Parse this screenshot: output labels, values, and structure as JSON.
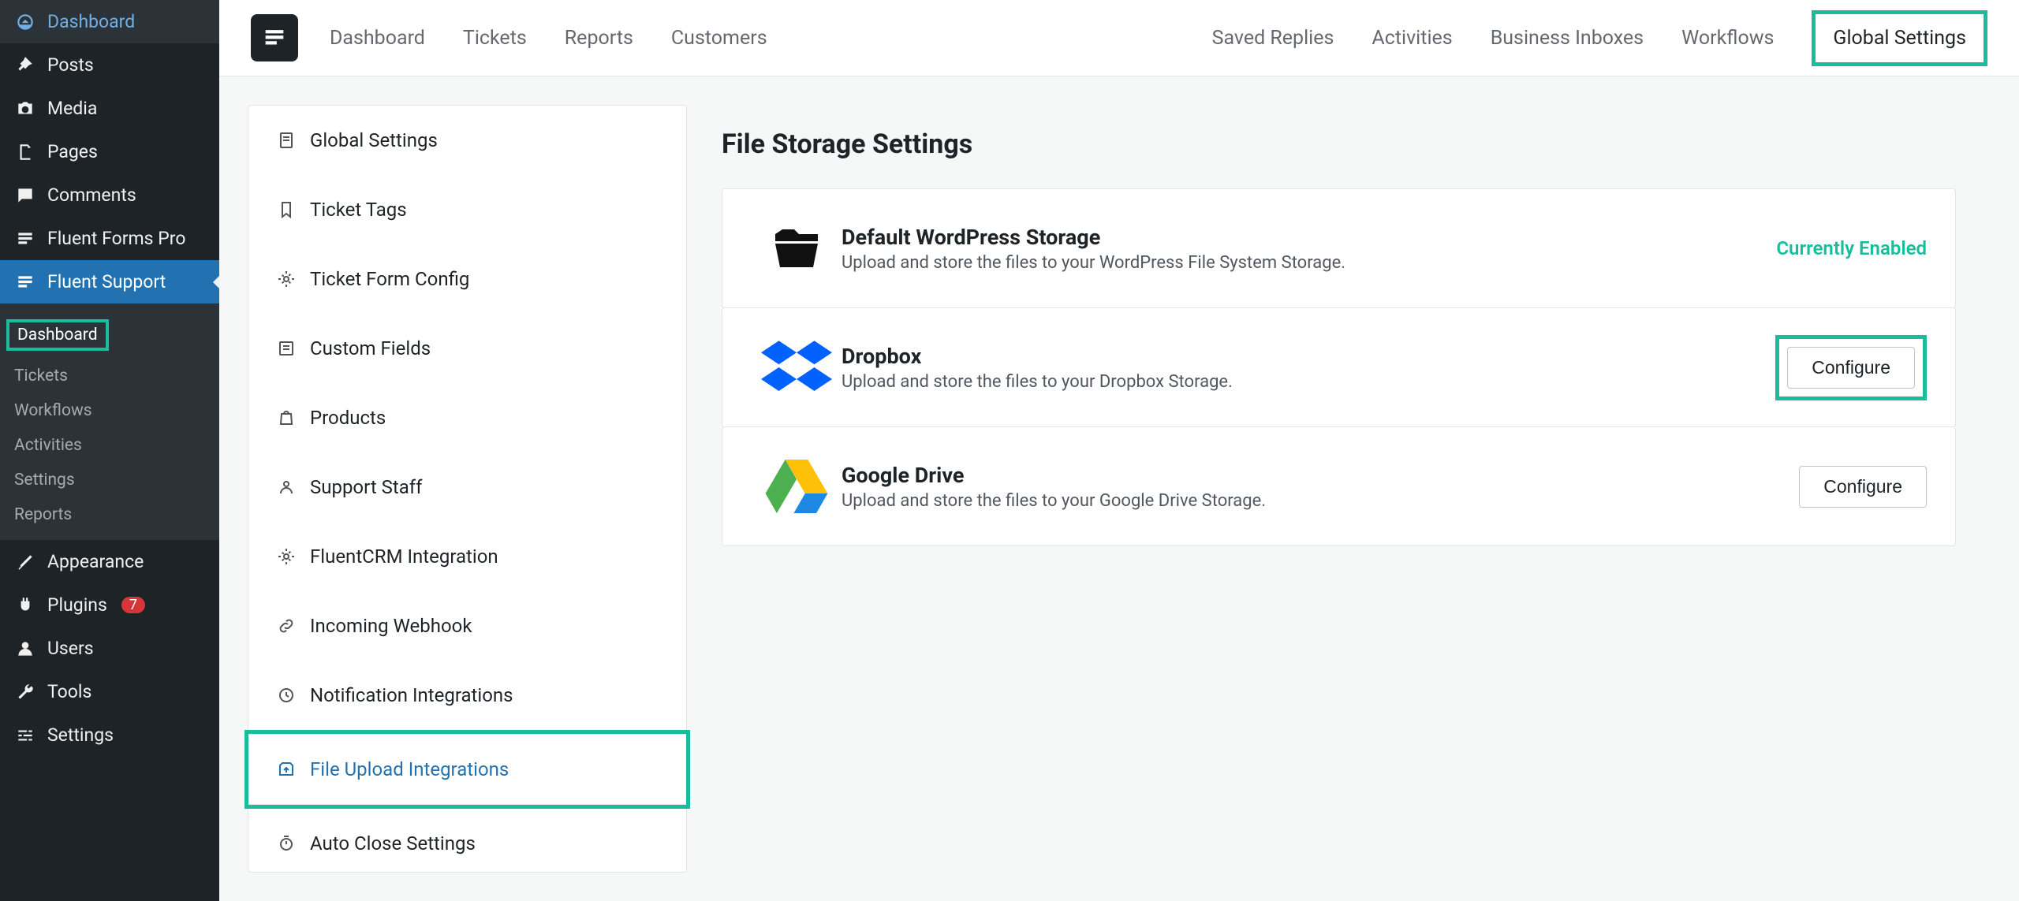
{
  "wp_sidebar": {
    "dashboard": "Dashboard",
    "posts": "Posts",
    "media": "Media",
    "pages": "Pages",
    "comments": "Comments",
    "fluent_forms": "Fluent Forms Pro",
    "fluent_support": "Fluent Support",
    "submenu": {
      "dashboard": "Dashboard",
      "tickets": "Tickets",
      "workflows": "Workflows",
      "activities": "Activities",
      "settings": "Settings",
      "reports": "Reports"
    },
    "appearance": "Appearance",
    "plugins": "Plugins",
    "plugins_badge": "7",
    "users": "Users",
    "tools": "Tools",
    "settings": "Settings"
  },
  "topbar": {
    "left": {
      "dashboard": "Dashboard",
      "tickets": "Tickets",
      "reports": "Reports",
      "customers": "Customers"
    },
    "right": {
      "saved_replies": "Saved Replies",
      "activities": "Activities",
      "business_inboxes": "Business Inboxes",
      "workflows": "Workflows",
      "global_settings": "Global Settings"
    }
  },
  "settings_sidebar": {
    "global_settings": "Global Settings",
    "ticket_tags": "Ticket Tags",
    "ticket_form_config": "Ticket Form Config",
    "custom_fields": "Custom Fields",
    "products": "Products",
    "support_staff": "Support Staff",
    "fluentcrm_integration": "FluentCRM Integration",
    "incoming_webhook": "Incoming Webhook",
    "notification_integrations": "Notification Integrations",
    "file_upload_integrations": "File Upload Integrations",
    "auto_close_settings": "Auto Close Settings"
  },
  "main": {
    "heading": "File Storage Settings",
    "storages": [
      {
        "title": "Default WordPress Storage",
        "desc": "Upload and store the files to your WordPress File System Storage.",
        "status": "Currently Enabled"
      },
      {
        "title": "Dropbox",
        "desc": "Upload and store the files to your Dropbox Storage.",
        "action": "Configure"
      },
      {
        "title": "Google Drive",
        "desc": "Upload and store the files to your Google Drive Storage.",
        "action": "Configure"
      }
    ]
  }
}
